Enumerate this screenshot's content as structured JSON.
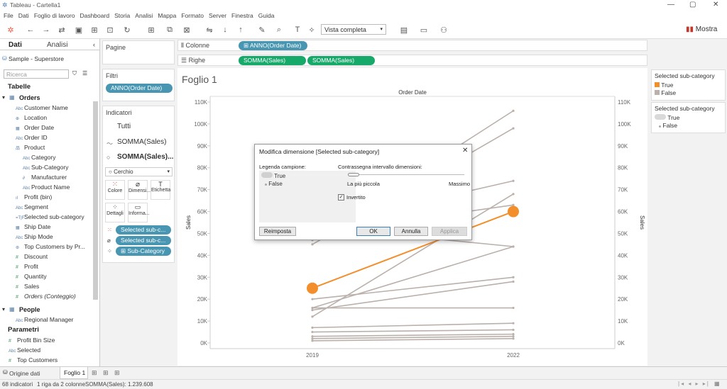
{
  "window": {
    "title": "Tableau - Cartella1"
  },
  "menu": [
    "File",
    "Dati",
    "Foglio di lavoro",
    "Dashboard",
    "Storia",
    "Analisi",
    "Mappa",
    "Formato",
    "Server",
    "Finestra",
    "Guida"
  ],
  "toolbar": {
    "view": "Vista completa",
    "showme": "Mostra"
  },
  "left": {
    "tab_data": "Dati",
    "tab_analysis": "Analisi",
    "datasource": "Sample - Superstore",
    "search_placeholder": "Ricerca",
    "tables_header": "Tabelle",
    "orders": "Orders",
    "fields": [
      "Customer Name",
      "Location",
      "Order Date",
      "Order ID",
      "Product",
      "Category",
      "Sub-Category",
      "Manufacturer",
      "Product Name",
      "Profit (bin)",
      "Segment",
      "Selected sub-category",
      "Ship Date",
      "Ship Mode",
      "Top Customers by Pr..."
    ],
    "measures": [
      "Discount",
      "Profit",
      "Quantity",
      "Sales",
      "Orders (Conteggio)"
    ],
    "people": "People",
    "people_fields": [
      "Regional Manager"
    ],
    "params_header": "Parametri",
    "params": [
      "Profit Bin Size",
      "Selected",
      "Top Customers"
    ]
  },
  "cards": {
    "pages": "Pagine",
    "filters": "Filtri",
    "filter_pill": "ANNO(Order Date)",
    "marks": "Indicatori",
    "all": "Tutti",
    "m1": "SOMMA(Sales)",
    "m2": "SOMMA(Sales)...",
    "marktype": "Cerchio",
    "btn": [
      "Colore",
      "Dimensi...",
      "Etichetta",
      "Dettagli",
      "Informa..."
    ],
    "pills": [
      "Selected sub-c...",
      "Selected sub-c...",
      "Sub-Category"
    ]
  },
  "shelves": {
    "columns": "Colonne",
    "col_pill": "ANNO(Order Date)",
    "rows": "Righe",
    "row_pill1": "SOMMA(Sales)",
    "row_pill2": "SOMMA(Sales)"
  },
  "sheet": {
    "title": "Foglio 1",
    "header": "Order Date",
    "yleft": "Sales",
    "yright": "Sales"
  },
  "legends": {
    "l1_title": "Selected sub-category",
    "l1_items": [
      "True",
      "False"
    ],
    "l2_title": "Selected sub-category",
    "l2_items": [
      "True",
      "False"
    ]
  },
  "dialog": {
    "title": "Modifica dimensione [Selected sub-category]",
    "legend_label": "Legenda campione:",
    "legend_items": [
      "True",
      "False"
    ],
    "range_label": "Contrassegna intervallo dimensioni:",
    "smallest": "La più piccola",
    "largest": "Massimo",
    "inverted": "Invertito",
    "reset": "Reimposta",
    "ok": "OK",
    "cancel": "Annulla",
    "apply": "Applica"
  },
  "bottom": {
    "datasource_tab": "Origine dati",
    "sheet_tab": "Foglio 1"
  },
  "status": {
    "marks": "68 indicatori",
    "rows": "1 riga da 2 colonne",
    "sum": "SOMMA(Sales): 1.239.608"
  },
  "colors": {
    "highlight": "#f28e2b",
    "other": "#bab0ac",
    "blue_pill": "#4996b2",
    "green_pill": "#16a96a"
  },
  "chart_data": {
    "type": "line",
    "x": [
      "2019",
      "2022"
    ],
    "ylim": [
      0,
      110000
    ],
    "yticks": [
      "0K",
      "10K",
      "20K",
      "30K",
      "40K",
      "50K",
      "60K",
      "70K",
      "80K",
      "90K",
      "100K",
      "110K"
    ],
    "highlight": {
      "name": "True",
      "values": [
        25000,
        60000
      ]
    },
    "series": [
      [
        47000,
        106000
      ],
      [
        45000,
        98000
      ],
      [
        53000,
        74000
      ],
      [
        12000,
        68000
      ],
      [
        50000,
        63000
      ],
      [
        53000,
        44000
      ],
      [
        16000,
        44000
      ],
      [
        20000,
        30000
      ],
      [
        15000,
        28000
      ],
      [
        16000,
        16000
      ],
      [
        7000,
        9000
      ],
      [
        5000,
        6000
      ],
      [
        3000,
        4000
      ],
      [
        2000,
        3000
      ],
      [
        1000,
        2000
      ]
    ]
  }
}
